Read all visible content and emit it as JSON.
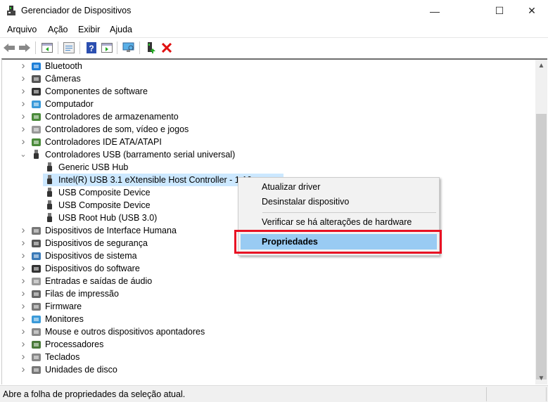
{
  "window": {
    "title": "Gerenciador de Dispositivos",
    "minimize": "—",
    "maximize": "☐",
    "close": "✕"
  },
  "menu": [
    "Arquivo",
    "Ação",
    "Exibir",
    "Ajuda"
  ],
  "toolbar": [
    "back-icon",
    "forward-icon",
    "show-hide-tree-icon",
    "properties-icon",
    "help-icon",
    "action-pane-icon",
    "scan-hardware-icon",
    "update-driver-icon",
    "uninstall-icon"
  ],
  "tree": {
    "categories_before": [
      {
        "label": "Bluetooth",
        "icon": "bluetooth-icon",
        "color": "#1e7fd8"
      },
      {
        "label": "Câmeras",
        "icon": "camera-icon",
        "color": "#555"
      },
      {
        "label": "Componentes de software",
        "icon": "software-component-icon",
        "color": "#333"
      },
      {
        "label": "Computador",
        "icon": "computer-icon",
        "color": "#3a9ad9"
      },
      {
        "label": "Controladores de armazenamento",
        "icon": "storage-icon",
        "color": "#4a8a3a"
      },
      {
        "label": "Controladores de som, vídeo e jogos",
        "icon": "sound-icon",
        "color": "#999"
      },
      {
        "label": "Controladores IDE ATA/ATAPI",
        "icon": "ide-icon",
        "color": "#4a8a3a"
      }
    ],
    "expanded": {
      "label": "Controladores USB (barramento serial universal)",
      "icon": "usb-icon",
      "children": [
        "Generic USB Hub",
        "Intel(R) USB 3.1 eXtensible Host Controller - 1.10",
        "USB Composite Device",
        "USB Composite Device",
        "USB Root Hub (USB 3.0)"
      ],
      "selected_index": 1
    },
    "categories_after": [
      {
        "label": "Dispositivos de Interface Humana",
        "icon": "hid-icon",
        "color": "#777"
      },
      {
        "label": "Dispositivos de segurança",
        "icon": "security-device-icon",
        "color": "#555"
      },
      {
        "label": "Dispositivos de sistema",
        "icon": "system-device-icon",
        "color": "#3a7ab8"
      },
      {
        "label": "Dispositivos do software",
        "icon": "software-device-icon",
        "color": "#333"
      },
      {
        "label": "Entradas e saídas de áudio",
        "icon": "audio-io-icon",
        "color": "#999"
      },
      {
        "label": "Filas de impressão",
        "icon": "printer-icon",
        "color": "#666"
      },
      {
        "label": "Firmware",
        "icon": "firmware-icon",
        "color": "#777"
      },
      {
        "label": "Monitores",
        "icon": "monitor-icon",
        "color": "#3a9ad9"
      },
      {
        "label": "Mouse e outros dispositivos apontadores",
        "icon": "mouse-icon",
        "color": "#888"
      },
      {
        "label": "Processadores",
        "icon": "processor-icon",
        "color": "#4a7a3a"
      },
      {
        "label": "Teclados",
        "icon": "keyboard-icon",
        "color": "#888"
      },
      {
        "label": "Unidades de disco",
        "icon": "disk-drive-icon",
        "color": "#777"
      }
    ]
  },
  "context_menu": {
    "items": [
      "Atualizar driver",
      "Desinstalar dispositivo",
      "Verificar se há alterações de hardware",
      "Propriedades"
    ],
    "highlighted": "Propriedades",
    "highlight_color": "#e81123"
  },
  "status": {
    "text": "Abre a folha de propriedades da seleção atual."
  }
}
